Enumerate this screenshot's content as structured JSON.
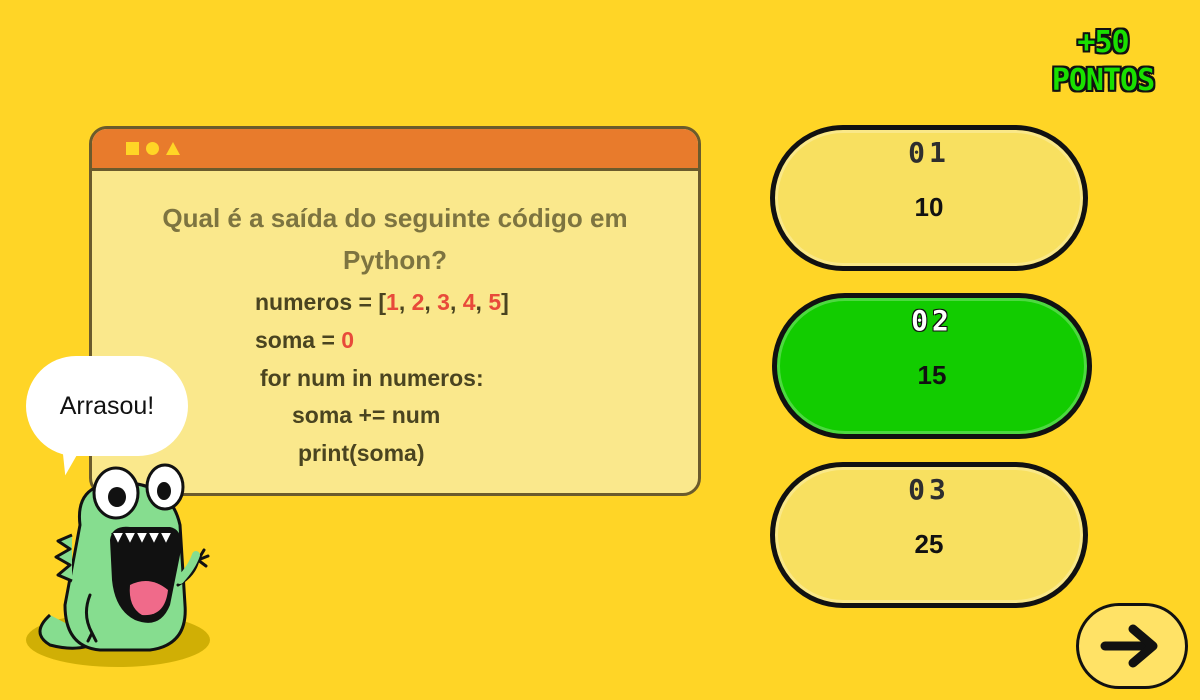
{
  "points": {
    "amount": "+50",
    "label": "PONTOS"
  },
  "question_window": {
    "controls": [
      "square-icon",
      "circle-icon",
      "triangle-icon"
    ],
    "question": "Qual é a saída do seguinte código em Python?",
    "code": {
      "line1_prefix": "numeros = [",
      "line1_n1": "1",
      "line1_n2": "2",
      "line1_n3": "3",
      "line1_n4": "4",
      "line1_n5": "5",
      "line1_suffix": "]",
      "line2_prefix": "soma = ",
      "line2_n": "0",
      "line3": "for num in numeros:",
      "line4": "soma += num",
      "line5": "print(soma)"
    }
  },
  "answers": [
    {
      "index": "01",
      "value": "10",
      "selected": false
    },
    {
      "index": "02",
      "value": "15",
      "selected": true
    },
    {
      "index": "03",
      "value": "25",
      "selected": false
    }
  ],
  "mascot": {
    "speech": "Arrasou!"
  },
  "next_button": {
    "icon": "arrow-right-icon"
  },
  "colors": {
    "background": "#FFD526",
    "window_bar": "#E87B2C",
    "window_body": "#FAE88C",
    "answer_default": "#F8E060",
    "answer_selected": "#12CC00",
    "points_text": "#19E000",
    "code_numbers": "#E84A3A",
    "mascot_body": "#86DD8F"
  }
}
